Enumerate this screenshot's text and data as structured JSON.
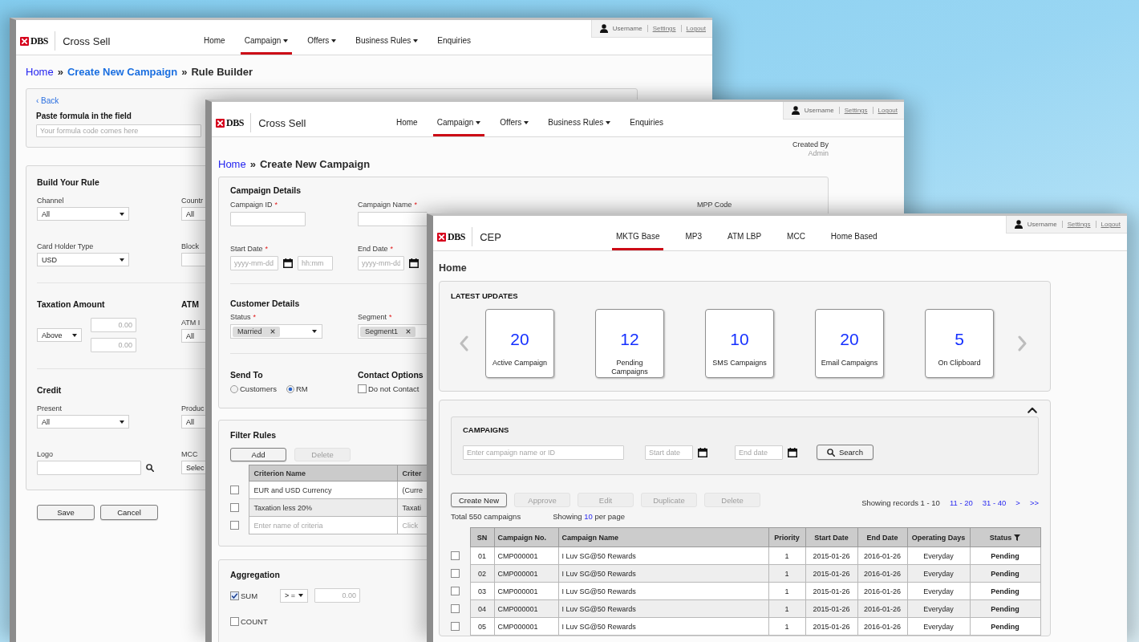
{
  "rule_builder_window": {
    "header": {
      "brand": {
        "logo": "DBS",
        "app": "Cross Sell"
      },
      "nav": [
        {
          "label": "Home",
          "dropdown": false,
          "selected": false
        },
        {
          "label": "Campaign",
          "dropdown": true,
          "selected": true
        },
        {
          "label": "Offers",
          "dropdown": true,
          "selected": false
        },
        {
          "label": "Business Rules",
          "dropdown": true,
          "selected": false
        },
        {
          "label": "Enquiries",
          "dropdown": false,
          "selected": false
        }
      ],
      "user": {
        "name": "Username",
        "links": [
          "Settings",
          "Logout"
        ]
      }
    },
    "breadcrumb": [
      {
        "text": "Home",
        "kind": "link"
      },
      {
        "text": "»",
        "kind": "separator"
      },
      {
        "text": "Create New Campaign",
        "kind": "strong_link"
      },
      {
        "text": "»",
        "kind": "separator"
      },
      {
        "text": "Rule Builder",
        "kind": "current"
      }
    ],
    "formula": {
      "back": "‹ Back",
      "label": "Paste formula in the field",
      "placeholder": "Your formula code comes here"
    },
    "sections": [
      {
        "heading": "Build Your Rule",
        "rows": [
          {
            "left": {
              "kind": "select",
              "label": "Channel",
              "value": "All"
            },
            "right": {
              "kind": "select",
              "label": "Countr",
              "value": "All"
            }
          },
          {
            "left": {
              "kind": "select",
              "label": "Card Holder Type",
              "value": "USD"
            },
            "right": {
              "kind": "input",
              "label": "Block"
            }
          }
        ]
      },
      {
        "heading": "Taxation Amount",
        "heading_right": "ATM",
        "rows": [
          {
            "left": {
              "kind": "range",
              "operator": "Above",
              "from_placeholder": "0.00",
              "to_placeholder": "0.00"
            },
            "right": {
              "kind": "select",
              "label": "ATM I",
              "value": "All"
            }
          }
        ]
      },
      {
        "heading": "Credit",
        "rows": [
          {
            "left": {
              "kind": "select",
              "label": "Present",
              "value": "All"
            },
            "right": {
              "kind": "select",
              "label": "Produc",
              "value": "All"
            }
          },
          {
            "left": {
              "kind": "search",
              "label": "Logo"
            },
            "right": {
              "kind": "select",
              "label": "MCC",
              "value": "Selec"
            }
          }
        ]
      }
    ],
    "buttons": [
      "Save",
      "Cancel"
    ]
  },
  "campaign_window": {
    "header": {
      "brand": {
        "logo": "DBS",
        "app": "Cross Sell"
      },
      "nav": [
        {
          "label": "Home",
          "dropdown": false,
          "selected": false
        },
        {
          "label": "Campaign",
          "dropdown": true,
          "selected": true
        },
        {
          "label": "Offers",
          "dropdown": true,
          "selected": false
        },
        {
          "label": "Business Rules",
          "dropdown": true,
          "selected": false
        },
        {
          "label": "Enquiries",
          "dropdown": false,
          "selected": false
        }
      ],
      "user": {
        "name": "Username",
        "links": [
          "Settings",
          "Logout"
        ]
      }
    },
    "created_by": {
      "label": "Created By",
      "value": "Admin"
    },
    "breadcrumb": [
      {
        "text": "Home",
        "kind": "link"
      },
      {
        "text": "»",
        "kind": "separator"
      },
      {
        "text": "Create New Campaign",
        "kind": "current"
      }
    ],
    "details": {
      "title": "Campaign Details",
      "campaign_id": {
        "label": "Campaign ID",
        "mark": "*"
      },
      "campaign_name": {
        "label": "Campaign Name",
        "mark": "*"
      },
      "mpp_code": {
        "label": "MPP Code"
      },
      "start_date": {
        "label": "Start Date",
        "mark": "*",
        "date_placeholder": "yyyy-mm-dd",
        "time_placeholder": "hh:mm"
      },
      "end_date": {
        "label": "End Date",
        "mark": "*",
        "date_placeholder": "yyyy-mm-dd"
      }
    },
    "customer": {
      "title": "Customer Details",
      "status": {
        "label": "Status",
        "mark": "*",
        "chips": [
          "Married"
        ]
      },
      "segment": {
        "label": "Segment",
        "mark": "*",
        "chips": [
          "Segment1"
        ]
      }
    },
    "send_to": {
      "title": "Send To",
      "options": [
        {
          "label": "Customers",
          "selected": false
        },
        {
          "label": "RM",
          "selected": true
        }
      ]
    },
    "contact_options": {
      "title": "Contact Options",
      "options": [
        {
          "label": "Do not Contact",
          "checked": false
        }
      ]
    },
    "filter_rules": {
      "title": "Filter Rules",
      "buttons": [
        {
          "label": "Add",
          "disabled": false
        },
        {
          "label": "Delete",
          "disabled": true
        }
      ],
      "columns": [
        "Criterion Name",
        "Criter"
      ],
      "rows": [
        {
          "checked": false,
          "cells": [
            "EUR and USD Currency",
            "(Curre"
          ]
        },
        {
          "checked": false,
          "cells": [
            "Taxation less 20%",
            "Taxati"
          ]
        }
      ],
      "new_row": {
        "checked": false,
        "placeholders": [
          "Enter name of criteria",
          "Click"
        ]
      }
    },
    "aggregation": {
      "title": "Aggregation",
      "items": [
        {
          "kind": "threshold",
          "label": "SUM",
          "checked": true,
          "operator": "> =",
          "placeholder": "0.00"
        },
        {
          "kind": "plain",
          "label": "COUNT",
          "checked": false
        }
      ]
    }
  },
  "home_window": {
    "header": {
      "brand": {
        "logo": "DBS",
        "app": "CEP"
      },
      "nav": [
        {
          "label": "MKTG Base",
          "dropdown": false,
          "selected": true
        },
        {
          "label": "MP3",
          "dropdown": false,
          "selected": false
        },
        {
          "label": "ATM LBP",
          "dropdown": false,
          "selected": false
        },
        {
          "label": "MCC",
          "dropdown": false,
          "selected": false
        },
        {
          "label": "Home Based",
          "dropdown": false,
          "selected": false
        }
      ],
      "user": {
        "name": "Username",
        "links": [
          "Settings",
          "Logout"
        ]
      }
    },
    "title": "Home",
    "latest_updates": {
      "title": "LATEST UPDATES",
      "tiles": [
        {
          "count": "20",
          "label": "Active Campaign"
        },
        {
          "count": "12",
          "label": "Pending Campaigns"
        },
        {
          "count": "10",
          "label": "SMS Campaigns"
        },
        {
          "count": "20",
          "label": "Email Campaigns"
        },
        {
          "count": "5",
          "label": "On Clipboard"
        }
      ]
    },
    "campaigns": {
      "title": "CAMPAIGNS",
      "expanded": true,
      "search": {
        "placeholder": "Enter campaign name or ID",
        "start_placeholder": "Start date",
        "end_placeholder": "End date",
        "button": "Search"
      },
      "actions": [
        {
          "label": "Create New",
          "disabled": false
        },
        {
          "label": "Approve",
          "disabled": true
        },
        {
          "label": "Edit",
          "disabled": true
        },
        {
          "label": "Duplicate",
          "disabled": true
        },
        {
          "label": "Delete",
          "disabled": true
        }
      ],
      "records": "Showing records 1 - 10",
      "pages": [
        "11 - 20",
        "31 - 40",
        ">",
        ">>"
      ],
      "total": "Total 550 campaigns",
      "page_size": {
        "before": "Showing",
        "value": "10",
        "after": "per page"
      },
      "table": {
        "columns": [
          "SN",
          "Campaign No.",
          "Campaign Name",
          "Priority",
          "Start Date",
          "End Date",
          "Operating Days",
          "Status"
        ],
        "rows": [
          {
            "checked": false,
            "cells": [
              "01",
              "CMP000001",
              "I Luv SG@50 Rewards",
              "1",
              "2015-01-26",
              "2016-01-26",
              "Everyday",
              "Pending"
            ]
          },
          {
            "checked": false,
            "cells": [
              "02",
              "CMP000001",
              "I Luv SG@50 Rewards",
              "1",
              "2015-01-26",
              "2016-01-26",
              "Everyday",
              "Pending"
            ]
          },
          {
            "checked": false,
            "cells": [
              "03",
              "CMP000001",
              "I Luv SG@50 Rewards",
              "1",
              "2015-01-26",
              "2016-01-26",
              "Everyday",
              "Pending"
            ]
          },
          {
            "checked": false,
            "cells": [
              "04",
              "CMP000001",
              "I Luv SG@50 Rewards",
              "1",
              "2015-01-26",
              "2016-01-26",
              "Everyday",
              "Pending"
            ]
          },
          {
            "checked": false,
            "cells": [
              "05",
              "CMP000001",
              "I Luv SG@50 Rewards",
              "1",
              "2015-01-26",
              "2016-01-26",
              "Everyday",
              "Pending"
            ]
          }
        ]
      }
    }
  }
}
